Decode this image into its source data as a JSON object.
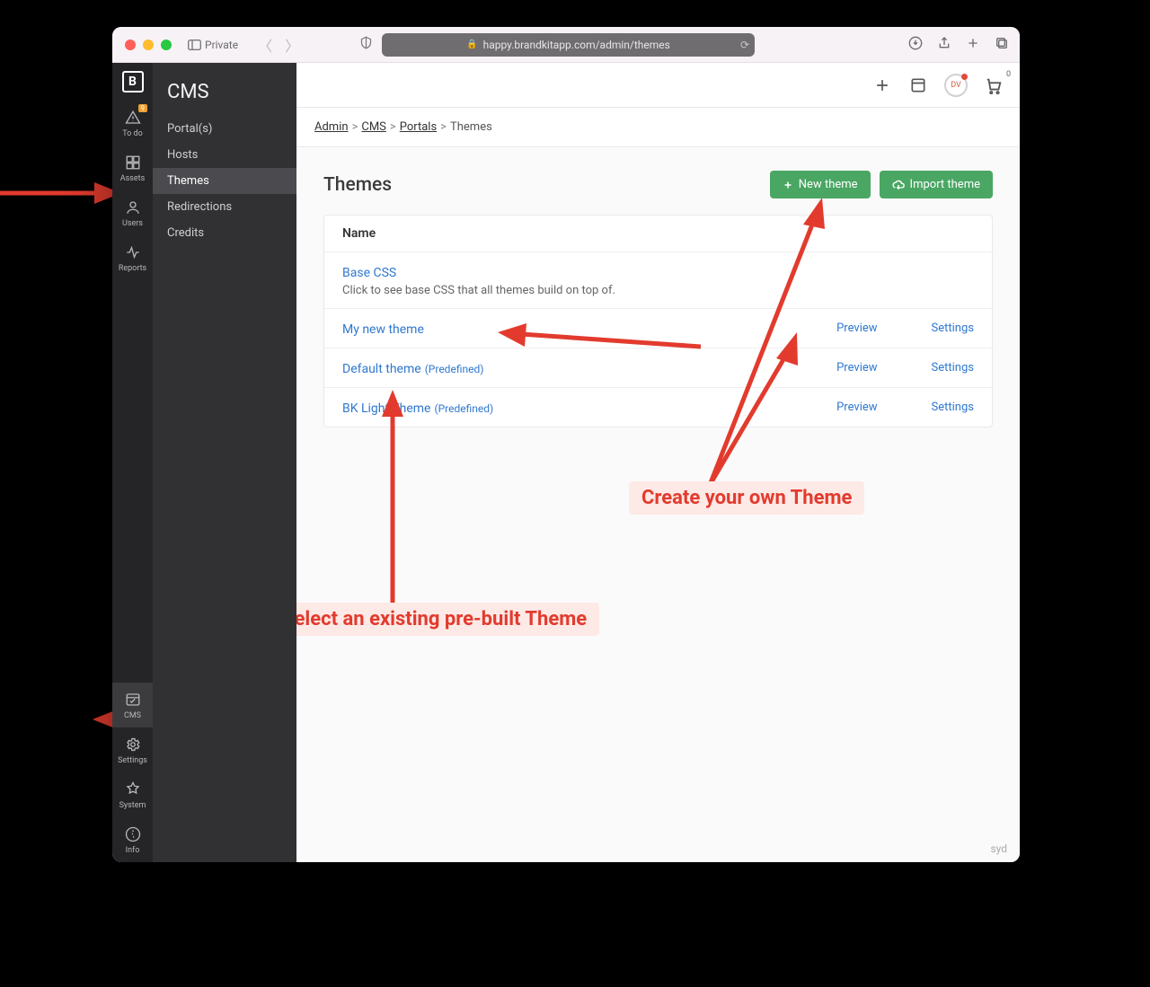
{
  "browser": {
    "private_label": "Private",
    "url": "happy.brandkitapp.com/admin/themes"
  },
  "rail": {
    "items": [
      {
        "label": "To do",
        "badge": "9"
      },
      {
        "label": "Assets"
      },
      {
        "label": "Users"
      },
      {
        "label": "Reports"
      }
    ],
    "bottom": [
      {
        "label": "CMS"
      },
      {
        "label": "Settings"
      },
      {
        "label": "System"
      },
      {
        "label": "Info"
      }
    ]
  },
  "sidepanel": {
    "title": "CMS",
    "items": [
      "Portal(s)",
      "Hosts",
      "Themes",
      "Redirections",
      "Credits"
    ],
    "active": "Themes"
  },
  "topbar": {
    "avatar_initials": "DV",
    "cart_count": "0"
  },
  "breadcrumbs": {
    "items": [
      "Admin",
      "CMS",
      "Portals",
      "Themes"
    ]
  },
  "page": {
    "title": "Themes",
    "new_btn": "New theme",
    "import_btn": "Import theme",
    "name_header": "Name",
    "preview_label": "Preview",
    "settings_label": "Settings",
    "predef_label": "(Predefined)",
    "rows": [
      {
        "name": "Base CSS",
        "sub": "Click to see base CSS that all themes build on top of.",
        "actions": false,
        "predef": false
      },
      {
        "name": "My new theme",
        "actions": true,
        "predef": false
      },
      {
        "name": "Default theme",
        "actions": true,
        "predef": true
      },
      {
        "name": "BK Light Theme",
        "actions": true,
        "predef": true
      }
    ]
  },
  "footer": {
    "region": "syd"
  },
  "annotations": {
    "create": "Create your own Theme",
    "select": "Select an existing pre-built Theme"
  }
}
